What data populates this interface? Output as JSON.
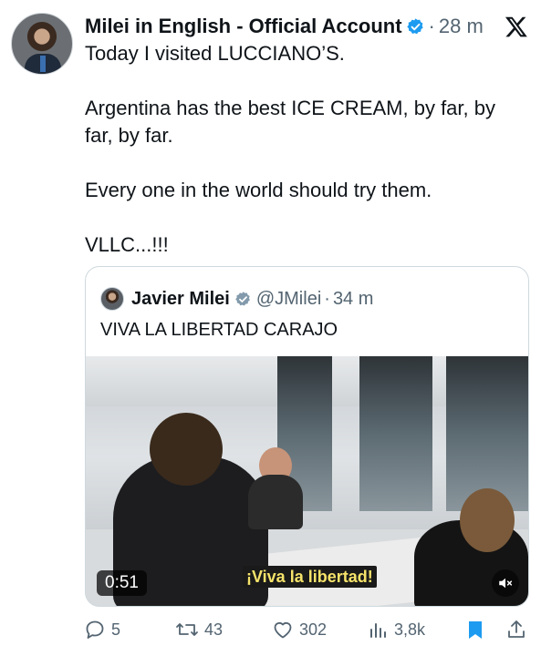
{
  "tweet": {
    "author_name": "Milei in English - Official Account",
    "verified_icon": "verified-badge-icon",
    "time": "28 m",
    "separator": "·",
    "platform_logo": "x-logo-icon",
    "text": "Today I visited LUCCIANO’S.\n\nArgentina has the best ICE CREAM, by far, by far, by far.\n\nEvery one in the world should try them.\n\nVLLC...!!!"
  },
  "quote": {
    "author_name": "Javier Milei",
    "handle": "@JMilei",
    "separator": "·",
    "time": "34 m",
    "text": "VIVA LA LIBERTAD CARAJO",
    "video": {
      "duration": "0:51",
      "subtitle": "¡Viva la libertad!",
      "mute_icon": "speaker-muted-icon"
    }
  },
  "actions": {
    "replies": "5",
    "reposts": "43",
    "likes": "302",
    "views": "3,8k",
    "bookmark_icon": "bookmark-icon",
    "share_icon": "share-icon"
  },
  "colors": {
    "text_primary": "#0f1419",
    "text_secondary": "#536471",
    "verified_blue": "#1d9bf0",
    "border": "#cfd9de"
  }
}
